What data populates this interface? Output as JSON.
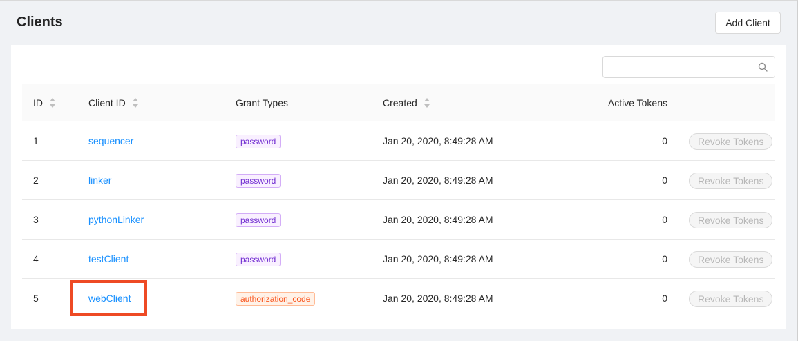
{
  "page": {
    "title": "Clients"
  },
  "toolbar": {
    "add_label": "Add Client"
  },
  "search": {
    "value": "",
    "placeholder": ""
  },
  "table": {
    "headers": {
      "id": "ID",
      "client_id": "Client ID",
      "grant_types": "Grant Types",
      "created": "Created",
      "active_tokens": "Active Tokens"
    },
    "rows": [
      {
        "id": "1",
        "client_id": "sequencer",
        "grant_type": "password",
        "created": "Jan 20, 2020, 8:49:28 AM",
        "active_tokens": "0",
        "action": "Revoke Tokens"
      },
      {
        "id": "2",
        "client_id": "linker",
        "grant_type": "password",
        "created": "Jan 20, 2020, 8:49:28 AM",
        "active_tokens": "0",
        "action": "Revoke Tokens"
      },
      {
        "id": "3",
        "client_id": "pythonLinker",
        "grant_type": "password",
        "created": "Jan 20, 2020, 8:49:28 AM",
        "active_tokens": "0",
        "action": "Revoke Tokens"
      },
      {
        "id": "4",
        "client_id": "testClient",
        "grant_type": "password",
        "created": "Jan 20, 2020, 8:49:28 AM",
        "active_tokens": "0",
        "action": "Revoke Tokens"
      },
      {
        "id": "5",
        "client_id": "webClient",
        "grant_type": "authorization_code",
        "created": "Jan 20, 2020, 8:49:28 AM",
        "active_tokens": "0",
        "action": "Revoke Tokens"
      }
    ]
  },
  "colors": {
    "link": "#1890ff",
    "tag_password": "#722ed1",
    "tag_authorization_code": "#fa541c",
    "highlight": "#ee4a24"
  },
  "icons": {
    "search": "search-icon",
    "sort": "sort-icon"
  }
}
